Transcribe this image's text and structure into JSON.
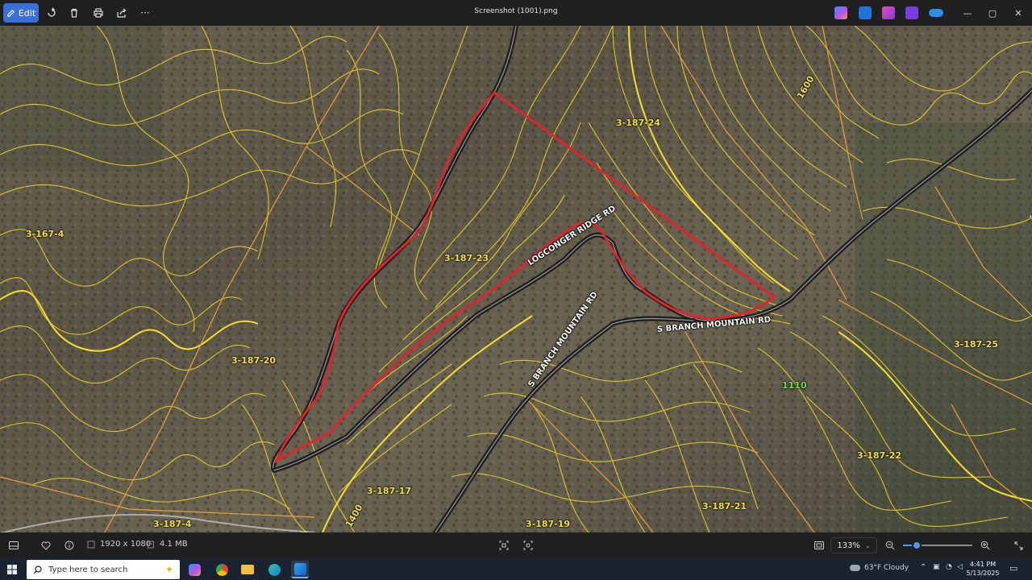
{
  "toolbar": {
    "edit_label": "Edit",
    "title": "Screenshot (1001).png",
    "more_label": "···",
    "window_controls": {
      "minimize": "—",
      "maximize": "▢",
      "close": "✕"
    },
    "app_icons": [
      "copilot-icon",
      "photoshop-express-icon",
      "designer-icon",
      "clipchamp-icon",
      "onedrive-icon"
    ]
  },
  "map": {
    "parcel_labels": [
      "3-187-24",
      "3-167-4",
      "3-187-23",
      "3-187-20",
      "3-187-25",
      "3-187-22",
      "3-187-17",
      "3-187-21",
      "3-187-19",
      "3-187-4"
    ],
    "contour_labels": [
      "1600",
      "1400"
    ],
    "elevation_label": "1110",
    "road_labels": [
      "LOGCONGER RIDGE RD",
      "S BRANCH MOUNTAIN RD",
      "S BRANCH MOUNTAIN RD"
    ],
    "colors": {
      "contour": "#e9d32a",
      "parcel_line": "#e8a13a",
      "boundary": "#e0242e",
      "road": "#1f1f1f"
    }
  },
  "status": {
    "dimensions": "1920 x 1080",
    "file_size": "4.1 MB",
    "zoom": "133%",
    "zoom_level_fraction": 0.2
  },
  "taskbar": {
    "search_placeholder": "Type here to search",
    "weather": "63°F  Cloudy",
    "time": "4:41 PM",
    "date": "5/13/2025"
  }
}
